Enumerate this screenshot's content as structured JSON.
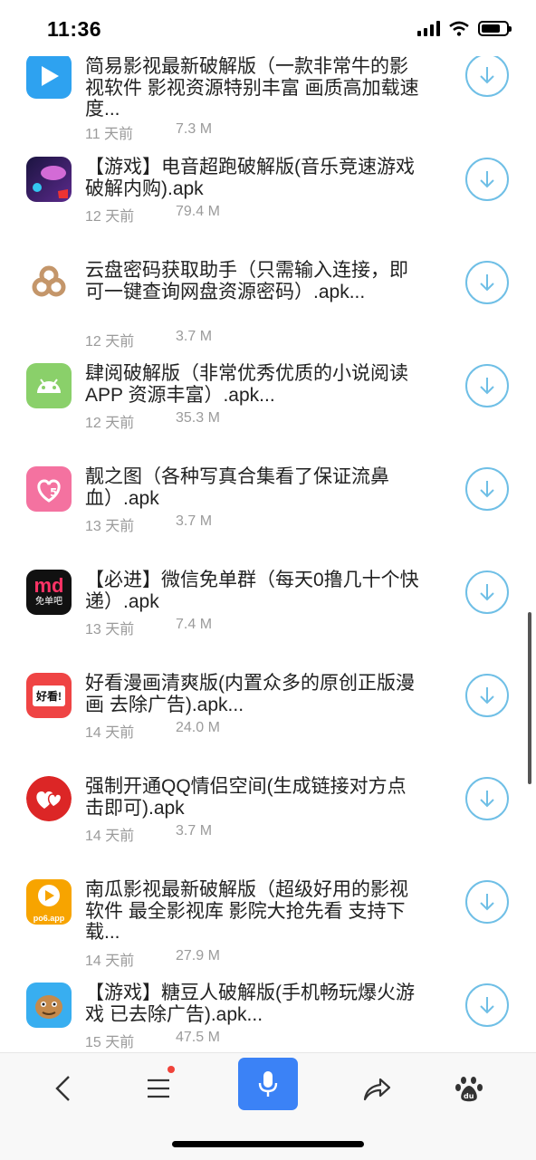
{
  "status_bar": {
    "time": "11:36",
    "battery_level": 0.75
  },
  "apps": [
    {
      "title": "简易影视最新破解版（一款非常牛的影视软件 影视资源特别丰富 画质高加载速度...",
      "date": "11 天前",
      "size": "7.3 M",
      "icon": "play-store-icon"
    },
    {
      "title": "【游戏】电音超跑破解版(音乐竞速游戏 破解内购).apk",
      "date": "12 天前",
      "size": "79.4 M",
      "icon": "racing-game-icon"
    },
    {
      "title": "云盘密码获取助手（只需输入连接，即可一键查询网盘资源密码）.apk...",
      "date": "12 天前",
      "size": "3.7 M",
      "icon": "cloud-rings-icon"
    },
    {
      "title": "肆阅破解版（非常优秀优质的小说阅读APP 资源丰富）.apk...",
      "date": "12 天前",
      "size": "35.3 M",
      "icon": "android-icon"
    },
    {
      "title": "靓之图（各种写真合集看了保证流鼻血）.apk",
      "date": "13 天前",
      "size": "3.7 M",
      "icon": "pink-heart-logo-icon"
    },
    {
      "title": "【必进】微信免单群（每天0撸几十个快递）.apk",
      "date": "13 天前",
      "size": "7.4 M",
      "icon": "md-logo-icon",
      "icon_text_top": "md",
      "icon_text_bottom": "免单吧"
    },
    {
      "title": "好看漫画清爽版(内置众多的原创正版漫画 去除广告).apk...",
      "date": "14 天前",
      "size": "24.0 M",
      "icon": "comic-logo-icon",
      "icon_text": "好看!"
    },
    {
      "title": "强制开通QQ情侣空间(生成链接对方点击即可).apk",
      "date": "14 天前",
      "size": "3.7 M",
      "icon": "double-heart-icon"
    },
    {
      "title": "南瓜影视最新破解版（超级好用的影视软件 最全影视库 影院大抢先看 支持下载...",
      "date": "14 天前",
      "size": "27.9 M",
      "icon": "pumpkin-video-icon",
      "icon_text": "po6.app"
    },
    {
      "title": "【游戏】糖豆人破解版(手机畅玩爆火游戏 已去除广告).apk...",
      "date": "15 天前",
      "size": "47.5 M",
      "icon": "game-character-icon"
    }
  ],
  "colors": {
    "accent": "#3b82f6",
    "download_ring": "#6fbfe6",
    "meta_text": "#9b9b9b",
    "badge": "#f0433a"
  },
  "bottom_nav": [
    "back-icon",
    "menu-icon",
    "microphone-icon",
    "share-icon",
    "baidu-paw-icon"
  ]
}
